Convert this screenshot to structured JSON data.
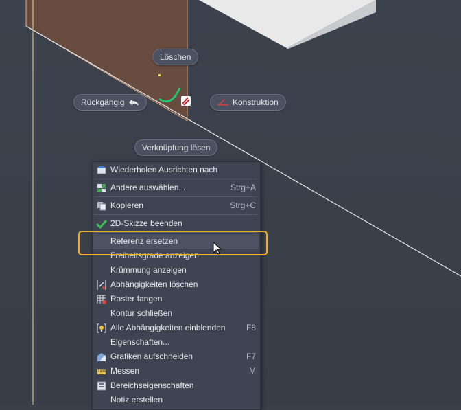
{
  "canvas": {
    "pills": {
      "loeschen": "Löschen",
      "rueckgaengig": "Rückgängig",
      "konstruktion": "Konstruktion",
      "verknuepfung": "Verknüpfung lösen"
    }
  },
  "menu": {
    "items": [
      {
        "label": "Wiederholen Ausrichten nach",
        "shortcut": "",
        "icon": "repeat-icon"
      },
      {
        "label": "Andere auswählen...",
        "shortcut": "Strg+A",
        "icon": "select-other-icon"
      },
      {
        "label": "Kopieren",
        "shortcut": "Strg+C",
        "icon": "copy-icon"
      },
      {
        "label": "2D-Skizze beenden",
        "shortcut": "",
        "icon": "checkmark-icon"
      },
      {
        "label": "Referenz ersetzen",
        "shortcut": "",
        "icon": ""
      },
      {
        "label": "Freiheitsgrade anzeigen",
        "shortcut": "",
        "icon": ""
      },
      {
        "label": "Krümmung anzeigen",
        "shortcut": "",
        "icon": ""
      },
      {
        "label": "Abhängigkeiten löschen",
        "shortcut": "",
        "icon": "delete-constraints-icon"
      },
      {
        "label": "Raster fangen",
        "shortcut": "",
        "icon": "grid-snap-icon"
      },
      {
        "label": "Kontur schließen",
        "shortcut": "",
        "icon": ""
      },
      {
        "label": "Alle Abhängigkeiten einblenden",
        "shortcut": "F8",
        "icon": "show-constraints-icon"
      },
      {
        "label": "Eigenschaften...",
        "shortcut": "",
        "icon": ""
      },
      {
        "label": "Grafiken aufschneiden",
        "shortcut": "F7",
        "icon": "slice-graphics-icon"
      },
      {
        "label": "Messen",
        "shortcut": "M",
        "icon": "measure-icon"
      },
      {
        "label": "Bereichseigenschaften",
        "shortcut": "",
        "icon": "region-properties-icon"
      },
      {
        "label": "Notiz erstellen",
        "shortcut": "",
        "icon": ""
      }
    ]
  },
  "colors": {
    "highlight": "#f1b31c",
    "sketch_face": "#6b4d3e",
    "arc_green": "#25c46b",
    "menu_bg": "#3f4452"
  }
}
